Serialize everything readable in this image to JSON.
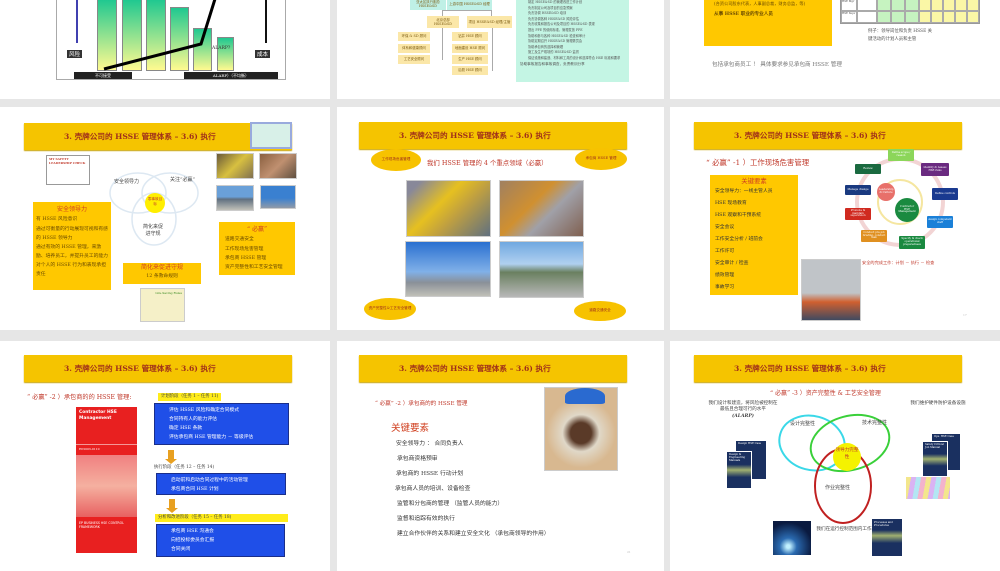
{
  "slides": {
    "s1": {
      "risk_label": "风险",
      "cost_label": "成本",
      "unacceptable_label": "不可接受",
      "alarp_label": "ALARP）（不均衡）",
      "alarp_question": "ALARP?"
    },
    "s2": {
      "org": {
        "top_left": "亚太区执行副总 HSSE&SD",
        "top_right": "上游中国 HSSE&SD 经理",
        "mid_left": "北京总部 HSSE&SD",
        "mid_right": "项目 HSSE&SD 经理/主管",
        "left_items": [
          "环保 & SD 顾问",
          "体系和健康顾问",
          "工艺安全顾问"
        ],
        "right_items": [
          "钻井 HSE 顾问",
          "地面建设 HSE 顾问",
          "生产 HSE 顾问",
          "后勤 HSE 顾问"
        ]
      },
      "duties": [
        "制定 HSSE&SD 的管理改进工作计划",
        "负责制定公司及项目的应急预案",
        "负责协调 HSSE&SD 培训",
        "负责协调各种 HSSE&SD 风险评估",
        "负责收集和报告公司及项目的 HSSE&SD 表现",
        "提出 PPE 的使用标准，管理发放 PPE",
        "协助和参与各种 HSSE&SD 检查和审计",
        "协助定期召开 HSSE&SD 管理委员会",
        "协助承包商的选择和管理",
        "施工及生产现场的 HSSE&SD 监督",
        "保证设施和建造、材料和工具的设计和选择符合 HSE 标准和要求",
        "协助事故报告和事故调查，负责教训分享"
      ]
    },
    "s3": {
      "box_lines": [
        "(合资公司股东代表，人事副总裁，财务总监，等)",
        "从事 HSSE 职业的专业人员"
      ],
      "table_rows": [
        "HSE Mgr",
        "HSE Supv"
      ],
      "caption_1": "例子：领导岗位和负责 HSSE 关",
      "caption_2": "键活动的计划人员和主管",
      "footer": "包括承包商员工 ！  具体要求参见承包商 HSSE 管理"
    },
    "title": "3. 壳牌公司的 HSSE 管理体系  –   3.6)  执行",
    "s4": {
      "venn_a": "安全领导力",
      "venn_b": "关注“必赢”",
      "venn_c": "简化来促进守规",
      "venn_center": "零事故目标",
      "leadership_card": "MY SAFETY LEADERSHIP CHECK",
      "box1_title": "安全领导力",
      "box1_items": [
        "有 HSSE 风险意识",
        "通过可衡量的行动展现可视和有感的 HSSE 领导力",
        "通过有效的 HSSE 管理，来激励、培养员工，并提升员工的能力",
        "对个人的 HSSE 行为和表现承担责任"
      ],
      "box2_title": "简化来促进守规",
      "box2_sub": "12 条救命规则",
      "box3_title": "“ 必赢”",
      "box3_items": [
        "道路交通安全",
        "工作现场危害管理",
        "承包商 HSSE 管理",
        "资产完整性和工艺安全管理"
      ],
      "lsr": "Life-Saving Rules"
    },
    "s5": {
      "subtitle": "我们 HSSE 管理的 4 个重点领域（必赢）",
      "callouts": [
        "工作现场危害管理",
        "承包商 HSSE 管理",
        "资产完整性&工艺安全管理",
        "道路交通安全"
      ]
    },
    "s6": {
      "subtitle": "“ 必赢” -1 ）工作现场危害管理",
      "box_title": "关键要素",
      "items": [
        "安全领导力：一线主管人员",
        "HSE 现场教育",
        "HSE 观察和干预系统",
        "安全会议",
        "工作安全分析 / 班前会",
        "工作许可",
        "安全审计 / 检查",
        "绩效管理",
        "事故学习"
      ],
      "cycle_nodes": [
        "Define scope / reason",
        "Identify & Assess HSE risks",
        "Define controls",
        "Assign competent staff",
        "Specify & check operational preparedness",
        "Conduct pre-job briefing, conduct task",
        "Promote & maintain supervision",
        "Manage change",
        "Review"
      ],
      "gear_1": "Leadership & Culture",
      "gear_2": "Contractor HSE Management",
      "caption": "安全的完成工作：计划 － 执行 － 检查",
      "page": "17"
    },
    "s7": {
      "subtitle": "“ 必赢” -2 ）承包商的的 HSSE 管理:",
      "phase1": "计划阶段（任务 1 – 任务 11)",
      "phase1_items": [
        "评估 HSSE 风险和确定合同模式",
        "合同持有人的能力评估",
        "确定 HSE 条款",
        "评估承包商 HSE 管理能力 － 等级评估"
      ],
      "phase2": "执行阶段（任务 12 – 任务 14)",
      "phase2_items": [
        "启动前和启动合同过程中的活动管理",
        "承包商合同 HSE 计划"
      ],
      "phase3": "分析和改进阶段（任务 15 – 任务 18)",
      "phase3_items": [
        "承包商 HSE 沟通会",
        "向招投标委员会汇报",
        "合同关闭"
      ],
      "book_title": "Contractor HSE Management",
      "book_code": "EP2003-0110",
      "book_footer": "EP BUSINESS HSE CONTROL FRAMEWORK"
    },
    "s8": {
      "subtitle": "“ 必赢” -2 ）承包商的的 HSSE 管理",
      "heading": "关键要素",
      "items": [
        "安全领导力 ： 合同负责人",
        "承包商资格预审",
        "承包商的 HSSE 行动计划",
        "承包商人员的培训、设备检查",
        "监管和分包商的管理 （监管人员的能力）",
        "监督和追踪有效的执行",
        "建立合作伙伴的关系和建立安全文化 （承包商领导的作用）"
      ],
      "page": "21"
    },
    "s9": {
      "subtitle": "“ 必赢” -3 ）资产完整性 & 工艺安全管理",
      "left_text": "我们设计和建造，将风险被控制在最低且合理可行的水平",
      "alarp": "(ALARP)",
      "right_text": "我们维护硬件防护设备设施",
      "bottom_text": "我们在运行控制范围内工作",
      "design": "设计完整性",
      "technical": "技术完整性",
      "operating": "作业完整性",
      "leadership": "领导力完整性",
      "book_left": "Design HSE Case",
      "book_left2": "Design & Engineering Manuals",
      "book_right": "Ops. HSE Case",
      "book_right2": "Safety Critical Job Manual",
      "book_bottom": "Processes and Procedures"
    }
  },
  "colors": {
    "title_bar": "#f5c400",
    "title_text": "#a0301a",
    "blue_box": "#1f4fe8",
    "teal_panel": "#c4f5e4"
  }
}
